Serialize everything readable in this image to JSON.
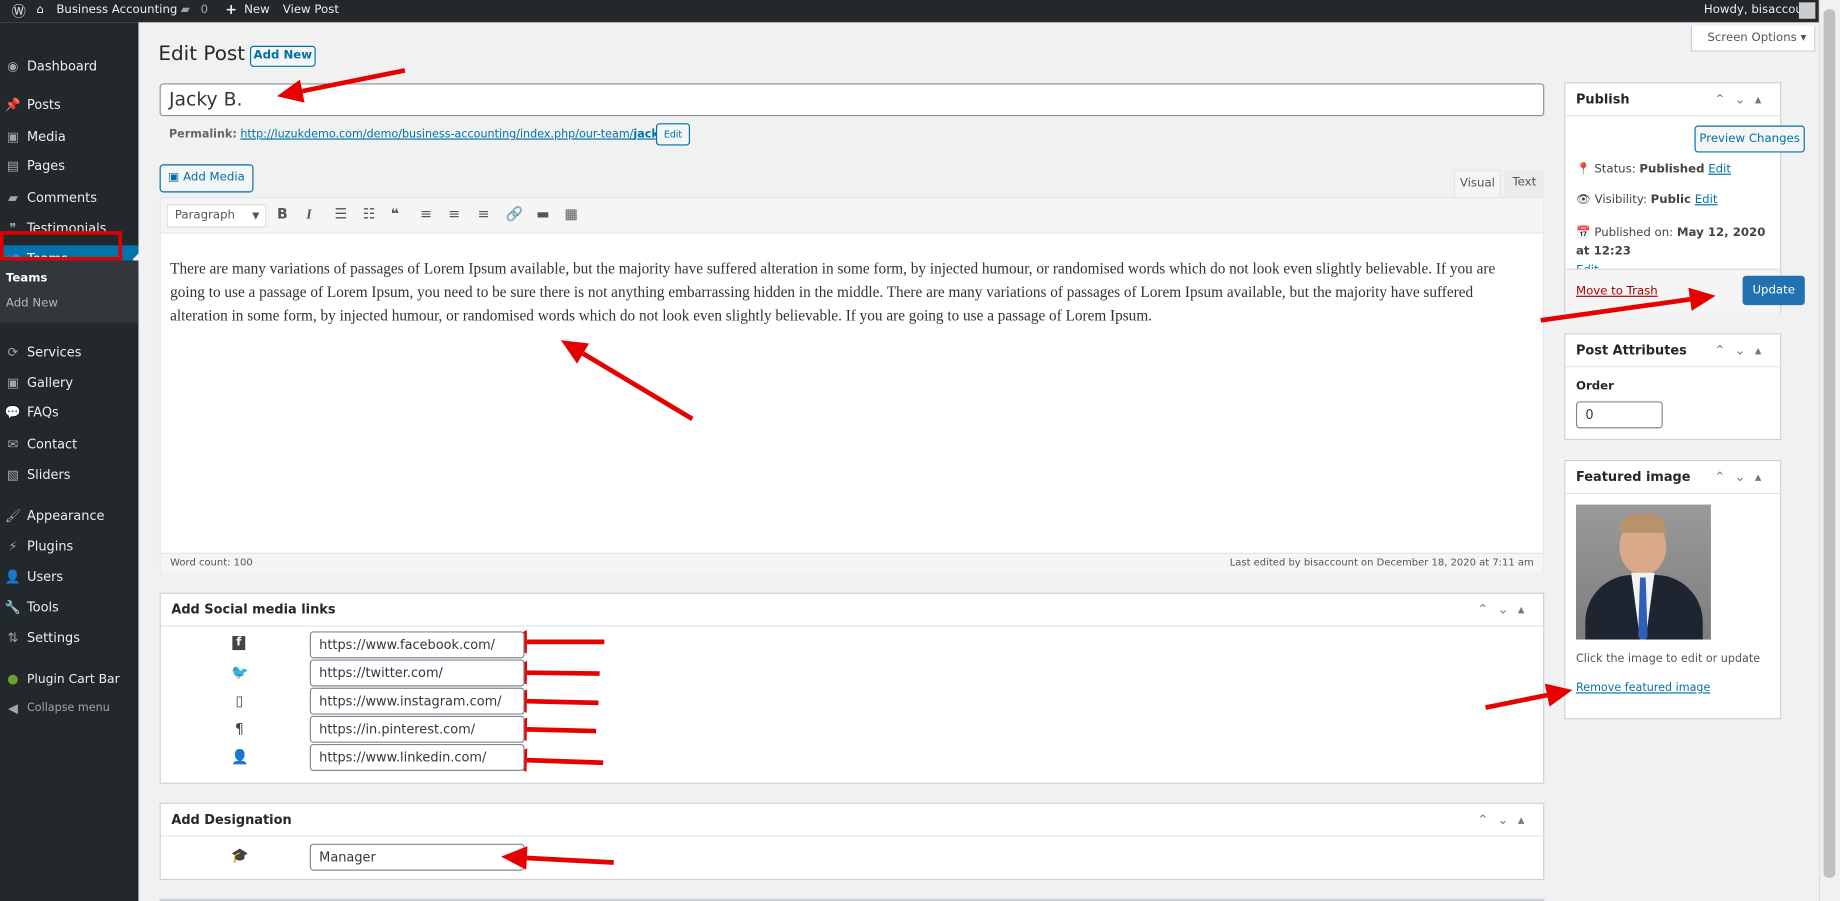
{
  "topbar": {
    "site_name": "Business Accounting",
    "comments_count": "0",
    "new_label": "New",
    "view_post": "View Post",
    "howdy": "Howdy, bisaccount"
  },
  "sidebar": {
    "items": [
      {
        "label": "Dashboard",
        "icon": "dashboard-icon"
      },
      {
        "label": "Posts",
        "icon": "pin-icon"
      },
      {
        "label": "Media",
        "icon": "media-icon"
      },
      {
        "label": "Pages",
        "icon": "pages-icon"
      },
      {
        "label": "Comments",
        "icon": "comment-icon"
      },
      {
        "label": "Testimonials",
        "icon": "testimonial-icon"
      },
      {
        "label": "Teams",
        "icon": "groups-icon",
        "active": true
      },
      {
        "label": "Services",
        "icon": "update-icon"
      },
      {
        "label": "Gallery",
        "icon": "gallery-icon"
      },
      {
        "label": "FAQs",
        "icon": "chat-icon"
      },
      {
        "label": "Contact",
        "icon": "email-icon"
      },
      {
        "label": "Sliders",
        "icon": "slides-icon"
      },
      {
        "label": "Appearance",
        "icon": "brush-icon"
      },
      {
        "label": "Plugins",
        "icon": "plugin-icon"
      },
      {
        "label": "Users",
        "icon": "user-icon"
      },
      {
        "label": "Tools",
        "icon": "wrench-icon"
      },
      {
        "label": "Settings",
        "icon": "settings-icon"
      },
      {
        "label": "Plugin Cart Bar",
        "icon": "cart-bar-icon"
      },
      {
        "label": "Collapse menu",
        "icon": "collapse-icon"
      }
    ],
    "submenu": [
      "Teams",
      "Add New"
    ]
  },
  "header": {
    "title": "Edit Post",
    "add_new": "Add New",
    "screen_options": "Screen Options"
  },
  "post": {
    "title": "Jacky B.",
    "permalink_label": "Permalink:",
    "permalink_base": "http://luzukdemo.com/demo/business-accounting/index.php/our-team/",
    "permalink_slug": "jacky-b",
    "permalink_end": "/",
    "edit": "Edit"
  },
  "editor": {
    "add_media": "Add Media",
    "tabs": [
      "Visual",
      "Text"
    ],
    "format": "Paragraph",
    "content": "There are many variations of passages of Lorem Ipsum available, but the majority have suffered alteration in some form, by injected humour, or randomised words which do not look even slightly believable. If you are going to use a passage of Lorem Ipsum, you need to be sure there is not anything embarrassing hidden in the middle. There are many variations of passages of Lorem Ipsum available, but the majority have suffered alteration in some form, by injected humour, or randomised words which do not look even slightly believable. If you are going to use a passage of Lorem Ipsum.",
    "word_count": "Word count: 100",
    "last_edited": "Last edited by bisaccount on December 18, 2020 at 7:11 am"
  },
  "social": {
    "title": "Add Social media links",
    "links": [
      {
        "icon": "facebook-icon",
        "glyph": "f",
        "value": "https://www.facebook.com/"
      },
      {
        "icon": "twitter-icon",
        "glyph": "🐦",
        "value": "https://twitter.com/"
      },
      {
        "icon": "instagram-icon",
        "glyph": "▯",
        "value": "https://www.instagram.com/"
      },
      {
        "icon": "pinterest-icon",
        "glyph": "¶",
        "value": "https://in.pinterest.com/"
      },
      {
        "icon": "linkedin-icon",
        "glyph": "👤",
        "value": "https://www.linkedin.com/"
      }
    ]
  },
  "designation": {
    "title": "Add Designation",
    "value": "Manager"
  },
  "publish": {
    "title": "Publish",
    "preview": "Preview Changes",
    "status_label": "Status:",
    "status": "Published",
    "visibility_label": "Visibility:",
    "visibility": "Public",
    "published_label": "Published on:",
    "published": "May 12, 2020 at 12:23",
    "edit": "Edit",
    "trash": "Move to Trash",
    "update": "Update"
  },
  "attributes": {
    "title": "Post Attributes",
    "order_label": "Order",
    "order": "0"
  },
  "featured": {
    "title": "Featured image",
    "hint": "Click the image to edit or update",
    "remove": "Remove featured image"
  },
  "colors": {
    "accent": "#0073aa",
    "sidebar": "#23282d",
    "annotation": "#e60000"
  }
}
